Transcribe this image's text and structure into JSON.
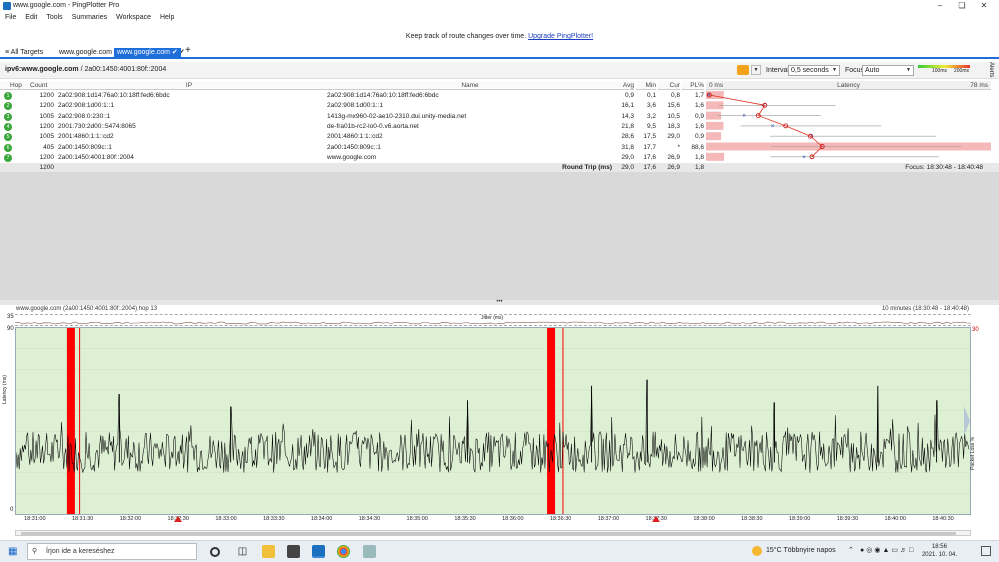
{
  "window": {
    "title": "www.google.com - PingPlotter Pro"
  },
  "menu": [
    "File",
    "Edit",
    "Tools",
    "Summaries",
    "Workspace",
    "Help"
  ],
  "banner": {
    "text": "Keep track of route changes over time.",
    "link": "Upgrade PingPlotter!"
  },
  "tabs": {
    "all_targets": "All Targets",
    "tab1": "www.google.com",
    "tab2": "www.google.com"
  },
  "target": {
    "bold": "ipv6:www.google.com",
    "rest": "/ 2a00:1450:4001:80f::2004"
  },
  "controls": {
    "interval_label": "Interval",
    "interval_value": "0,5 seconds",
    "focus_label": "Focus",
    "focus_value": "Auto",
    "scale_100": "100ms",
    "scale_200": "200ms",
    "alerts": "Alerts"
  },
  "table": {
    "headers": {
      "hop": "Hop",
      "count": "Count",
      "ip": "IP",
      "name": "Name",
      "avg": "Avg",
      "min": "Min",
      "cur": "Cur",
      "pl": "PL%",
      "zero": "0 ms",
      "latency": "Latency",
      "max": "78 ms"
    },
    "rows": [
      {
        "hop": "1",
        "count": "1200",
        "ip": "2a02:908:1d14:76a0:10:18ff:fed6:6bdc",
        "name": "2a02:908:1d14:76a0:10:18ff:fed6:6bdc",
        "avg": "0,9",
        "min": "0,1",
        "cur": "0,8",
        "pl": "1,7"
      },
      {
        "hop": "2",
        "count": "1200",
        "ip": "2a02:908:1d00:1::1",
        "name": "2a02:908:1d00:1::1",
        "avg": "16,1",
        "min": "3,6",
        "cur": "15,6",
        "pl": "1,6"
      },
      {
        "hop": "3",
        "count": "1005",
        "ip": "2a02:908:0:230::1",
        "name": "1413g-mx960-02-ae10-2310.dui.unity-media.net",
        "avg": "14,3",
        "min": "3,2",
        "cur": "10,5",
        "pl": "0,9"
      },
      {
        "hop": "4",
        "count": "1200",
        "ip": "2001:730:2d00::5474:8065",
        "name": "de-fra01b-rc2-lo0-0.v6.aorta.net",
        "avg": "21,8",
        "min": "9,5",
        "cur": "18,3",
        "pl": "1,6"
      },
      {
        "hop": "5",
        "count": "1005",
        "ip": "2001:4860:1:1::cd2",
        "name": "2001:4860:1:1::cd2",
        "avg": "28,6",
        "min": "17,5",
        "cur": "29,0",
        "pl": "0,9"
      },
      {
        "hop": "6",
        "count": "405",
        "ip": "2a00:1450:809c::1",
        "name": "2a00:1450:809c::1",
        "avg": "31,8",
        "min": "17,7",
        "cur": "*",
        "pl": "88,6"
      },
      {
        "hop": "7",
        "count": "1200",
        "ip": "2a00:1450:4001:80f::2004",
        "name": "www.google.com",
        "avg": "29,0",
        "min": "17,6",
        "cur": "26,9",
        "pl": "1,8"
      }
    ],
    "round_trip": {
      "count": "1200",
      "label": "Round Trip (ms)",
      "avg": "29,0",
      "min": "17,6",
      "cur": "26,9",
      "pl": "1,8",
      "focus": "Focus: 18:30:48 - 18:40:48"
    }
  },
  "graph": {
    "title": "www.google.com (2a00:1450:4001:80f::2004) hop 13",
    "range": "10 minutes (18:30:48 - 18:40:48)",
    "jitter_label": "Jitter (ms)",
    "jitter_max": "35",
    "y_max": "90",
    "y_min": "0",
    "y_label": "Latency (ms)",
    "right_label": "Packet Loss %",
    "right_max": "30",
    "x_ticks": [
      "18:31:00",
      "18:31:30",
      "18:32:00",
      "18:32:30",
      "18:33:00",
      "18:33:30",
      "18:34:00",
      "18:34:30",
      "18:35:00",
      "18:35:30",
      "18:36:00",
      "18:36:30",
      "18:37:00",
      "18:37:30",
      "18:38:00",
      "18:38:30",
      "18:39:00",
      "18:39:30",
      "18:40:00",
      "18:40:30"
    ],
    "colors": {
      "bg": "#ddf0d4",
      "loss": "#ff0000",
      "line": "#000000"
    }
  },
  "chart_data": {
    "type": "line",
    "title": "www.google.com (2a00:1450:4001:80f::2004) hop 13",
    "ylabel": "Latency (ms)",
    "ylim": [
      0,
      90
    ],
    "xlim": [
      "18:30:48",
      "18:40:48"
    ],
    "typical_latency_range": [
      20,
      40
    ],
    "spike_times_ms": [
      {
        "t": "18:31:53",
        "v": 58
      },
      {
        "t": "18:33:03",
        "v": 52
      },
      {
        "t": "18:35:32",
        "v": 55
      },
      {
        "t": "18:36:50",
        "v": 62
      },
      {
        "t": "18:37:25",
        "v": 65
      },
      {
        "t": "18:38:45",
        "v": 54
      },
      {
        "t": "18:39:50",
        "v": 62
      },
      {
        "t": "18:40:27",
        "v": 55
      }
    ],
    "packet_loss_events": [
      {
        "t": "18:31:20",
        "label": "loss band"
      },
      {
        "t": "18:31:28",
        "label": "loss line"
      },
      {
        "t": "18:36:22",
        "label": "loss band"
      },
      {
        "t": "18:36:32",
        "label": "loss line"
      }
    ],
    "markers": [
      "18:32:30",
      "18:37:30"
    ]
  },
  "taskbar": {
    "search_placeholder": "Írjon ide a kereséshez",
    "weather": "15°C  Többnyire napos",
    "time": "18:56",
    "date": "2021. 10. 04."
  }
}
